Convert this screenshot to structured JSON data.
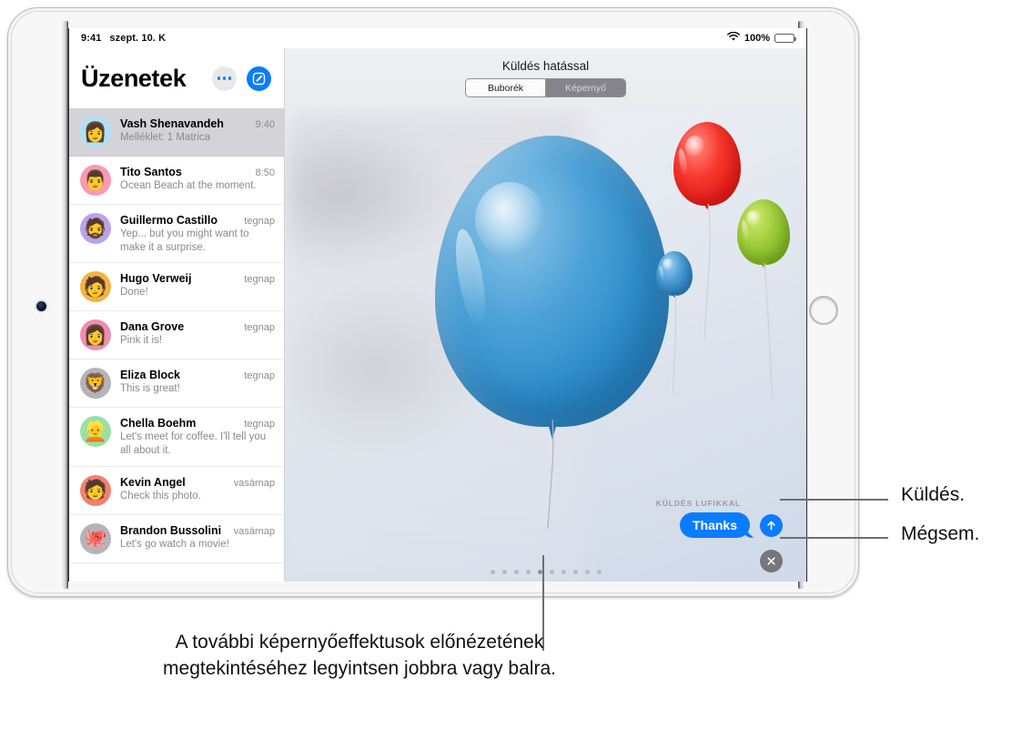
{
  "status_bar": {
    "time": "9:41",
    "date": "szept. 10. K",
    "battery_percent": "100%",
    "wifi_icon": "wifi-icon",
    "battery_icon": "battery-icon"
  },
  "sidebar": {
    "title": "Üzenetek",
    "more_icon": "more-ellipsis-icon",
    "compose_icon": "compose-pencil-icon",
    "conversations": [
      {
        "name": "Vash Shenavandeh",
        "time": "9:40",
        "preview": "Melléklet: 1 Matrica",
        "avatar_color": "#aee1f7",
        "avatar_glyph": "👩",
        "selected": true
      },
      {
        "name": "Tito Santos",
        "time": "8:50",
        "preview": "Ocean Beach at the moment.",
        "avatar_color": "#f79ab4",
        "avatar_glyph": "👨",
        "selected": false
      },
      {
        "name": "Guillermo Castillo",
        "time": "tegnap",
        "preview": "Yep... but you might want to make it a surprise.",
        "avatar_color": "#b8a4ec",
        "avatar_glyph": "🧔",
        "selected": false
      },
      {
        "name": "Hugo Verweij",
        "time": "tegnap",
        "preview": "Done!",
        "avatar_color": "#f6b33f",
        "avatar_glyph": "🧑",
        "selected": false
      },
      {
        "name": "Dana Grove",
        "time": "tegnap",
        "preview": "Pink it is!",
        "avatar_color": "#f08cb0",
        "avatar_glyph": "👩",
        "selected": false
      },
      {
        "name": "Eliza Block",
        "time": "tegnap",
        "preview": "This is great!",
        "avatar_color": "#b4b4b9",
        "avatar_glyph": "🦁",
        "selected": false
      },
      {
        "name": "Chella Boehm",
        "time": "tegnap",
        "preview": "Let's meet for coffee. I'll tell you all about it.",
        "avatar_color": "#9ae0a3",
        "avatar_glyph": "👱",
        "selected": false
      },
      {
        "name": "Kevin Angel",
        "time": "vasárnap",
        "preview": "Check this photo.",
        "avatar_color": "#f57f72",
        "avatar_glyph": "🧑",
        "selected": false
      },
      {
        "name": "Brandon Bussolini",
        "time": "vasárnap",
        "preview": "Let's go watch a movie!",
        "avatar_color": "#b4b4b9",
        "avatar_glyph": "🐙",
        "selected": false
      }
    ]
  },
  "effect_panel": {
    "title": "Küldés hatással",
    "segments": [
      {
        "label": "Buborék",
        "active": false
      },
      {
        "label": "Képernyő",
        "active": true
      }
    ],
    "effect_label": "KÜLDÉS LUFIKKAL",
    "message_text": "Thanks",
    "send_icon": "up-arrow-icon",
    "cancel_icon": "close-x-icon",
    "page_dots_total": 10,
    "page_dots_active_index": 4,
    "balloons": [
      {
        "name": "balloon-main",
        "color": "#2f8dc9"
      },
      {
        "name": "balloon-red",
        "color": "#e8201a"
      },
      {
        "name": "balloon-green",
        "color": "#86bb29"
      },
      {
        "name": "balloon-blue",
        "color": "#2f85c2"
      }
    ]
  },
  "callouts": {
    "send": "Küldés.",
    "cancel": "Mégsem.",
    "caption": "A további képernyőeffektusok előnézetének megtekintéséhez legyintsen jobbra vagy balra."
  },
  "colors": {
    "accent_blue": "#0a7cff",
    "selected_row": "#d3d3d8",
    "secondary_text": "#8a8a8e"
  }
}
